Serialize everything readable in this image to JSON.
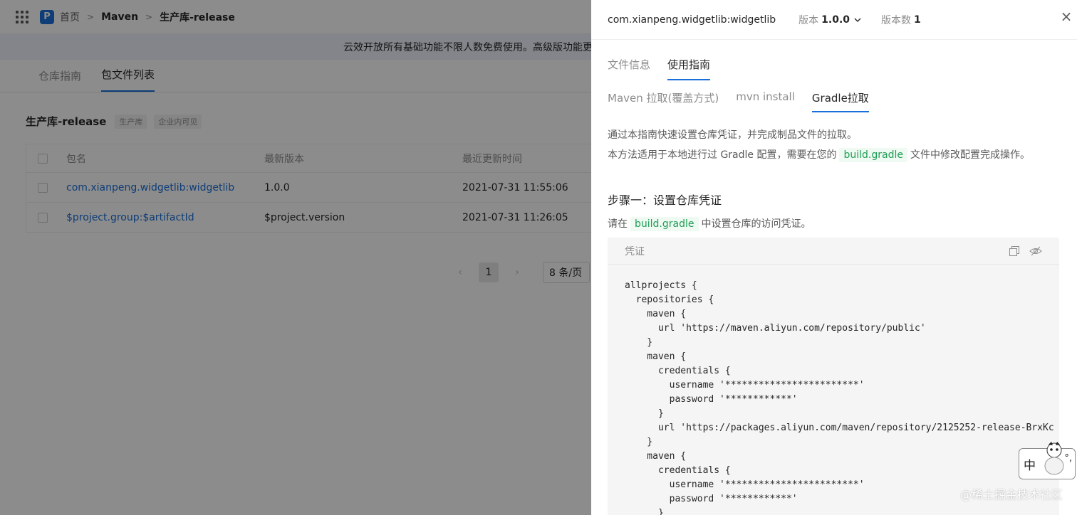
{
  "topbar": {
    "breadcrumbs": [
      "首页",
      "Maven",
      "生产库-release"
    ],
    "logo_letter": "P"
  },
  "banner": {
    "text": "云效开放所有基础功能不限人数免费使用。高级版功能更"
  },
  "page_tabs": [
    "仓库指南",
    "包文件列表"
  ],
  "repo": {
    "name": "生产库-release",
    "tags": [
      "生产库",
      "企业内可见"
    ]
  },
  "table": {
    "headers": [
      "包名",
      "最新版本",
      "最近更新时间"
    ],
    "rows": [
      {
        "name": "com.xianpeng.widgetlib:widgetlib",
        "version": "1.0.0",
        "updated": "2021-07-31 11:55:06"
      },
      {
        "name": "$project.group:$artifactId",
        "version": "$project.version",
        "updated": "2021-07-31 11:26:05"
      }
    ]
  },
  "pager": {
    "prev": "‹",
    "page": "1",
    "next": "›",
    "size": "8 条/页"
  },
  "drawer": {
    "title": "com.xianpeng.widgetlib:widgetlib",
    "version_label": "版本",
    "version_value": "1.0.0",
    "count_label": "版本数",
    "count_value": "1",
    "close": "×",
    "tabs": [
      "文件信息",
      "使用指南"
    ],
    "subtabs": [
      "Maven 拉取(覆盖方式)",
      "mvn install",
      "Gradle拉取"
    ],
    "intro_line1": "通过本指南快速设置仓库凭证，并完成制品文件的拉取。",
    "intro_line2_pre": "本方法适用于本地进行过 Gradle 配置，需要在您的",
    "intro_chip": "build.gradle",
    "intro_line2_post": "文件中修改配置完成操作。",
    "step1_title": "步骤一：设置仓库凭证",
    "step1_pre": "请在",
    "step1_chip": "build.gradle",
    "step1_post": "中设置仓库的访问凭证。",
    "code_title": "凭证",
    "code": "allprojects {\n  repositories {\n    maven {\n      url 'https://maven.aliyun.com/repository/public'\n    }\n    maven {\n      credentials {\n        username '************************'\n        password '************'\n      }\n      url 'https://packages.aliyun.com/maven/repository/2125252-release-BrxKc\n    }\n    maven {\n      credentials {\n        username '************************'\n        password '************'\n      }"
  },
  "watermark": "@稀土掘金技术社区",
  "ime": {
    "label": "中",
    "punct": "°,"
  },
  "colors": {
    "accent": "#1b6fd9",
    "code_chip": "#1f9d55"
  }
}
